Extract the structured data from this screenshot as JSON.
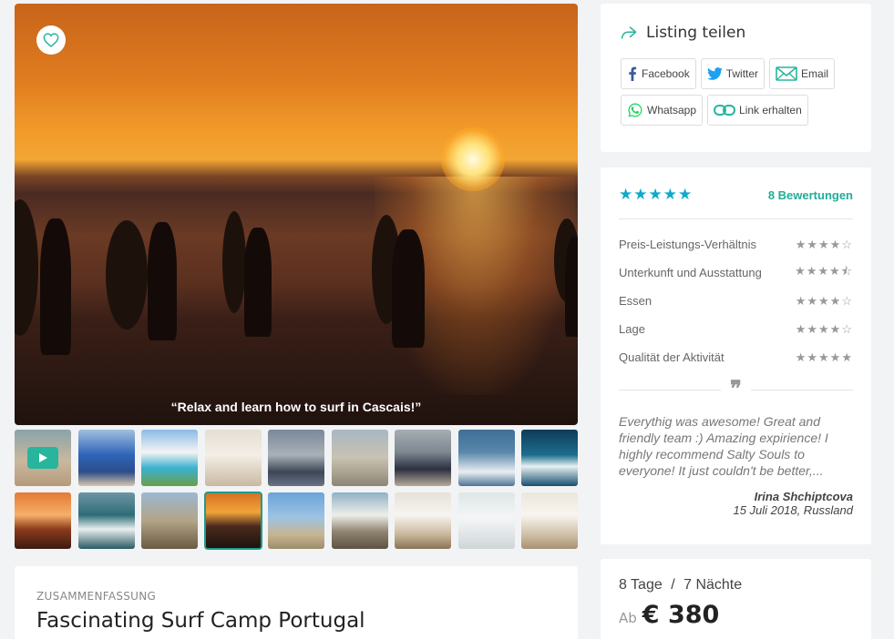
{
  "gallery": {
    "caption": "“Relax and learn how to surf in Cascais!”",
    "thumbnails": [
      {
        "bg": "linear-gradient(180deg,#8aa3a8 0%,#c9b8a0 55%,#b59a7a 100%)",
        "video": true
      },
      {
        "bg": "linear-gradient(180deg,#9fc0de 0%,#2f63b8 45%,#2d4d8a 75%,#d7c7ad 100%)"
      },
      {
        "bg": "linear-gradient(180deg,#8bbbe6 0%,#f4f4f4 40%,#3bb1d0 68%,#6a9f4a 100%)"
      },
      {
        "bg": "linear-gradient(180deg,#e5ded3 0%,#f3eee6 45%,#c9b9a0 100%)"
      },
      {
        "bg": "linear-gradient(180deg,#7a8899 0%,#a9b0b8 45%,#3d4656 75%,#6b7485 100%)"
      },
      {
        "bg": "linear-gradient(180deg,#a8b7c2 0%,#c9c2b2 50%,#8d8574 100%)"
      },
      {
        "bg": "linear-gradient(180deg,#a7aeb3 0%,#7e8790 40%,#2c3040 70%,#b7ab98 100%)"
      },
      {
        "bg": "linear-gradient(180deg,#3e6f96 0%,#5a87aa 40%,#e9eef2 75%,#4d7495 100%)"
      },
      {
        "bg": "linear-gradient(180deg,#0e3b58 0%,#1d6e8f 45%,#e8f0f2 65%,#154f6e 100%)"
      },
      {
        "bg": "linear-gradient(180deg,#e37a35 0%,#f5b06a 40%,#8c3b1c 65%,#3d1a10 100%)"
      },
      {
        "bg": "linear-gradient(180deg,#6e95a4 0%,#2e6c78 40%,#e9efef 65%,#2a5a63 100%)"
      },
      {
        "bg": "linear-gradient(180deg,#9cb9d3 0%,#b2a487 50%,#6a5a42 100%)"
      },
      {
        "bg": "linear-gradient(180deg,#d56f22 0%,#f1a43a 35%,#4a2a1d 60%,#1e120d 100%)",
        "active": true
      },
      {
        "bg": "linear-gradient(180deg,#6aa3d8 0%,#9ec3e3 45%,#c7b591 75%,#9d8c6b 100%)"
      },
      {
        "bg": "linear-gradient(180deg,#8fb1c6 0%,#efeee8 40%,#8e8270 70%,#5f5243 100%)"
      },
      {
        "bg": "linear-gradient(180deg,#e6e1d7 0%,#f7f5f0 40%,#c9b69a 75%,#8b7355 100%)"
      },
      {
        "bg": "linear-gradient(180deg,#dfe6e8 0%,#f4f6f6 45%,#cfd6d8 100%)"
      },
      {
        "bg": "linear-gradient(180deg,#ece6dc 0%,#f8f5ef 40%,#c8b79c 80%,#a89072 100%)"
      }
    ]
  },
  "summary": {
    "eyebrow": "ZUSAMMENFASSUNG",
    "title": "Fascinating Surf Camp Portugal"
  },
  "share": {
    "title": "Listing teilen",
    "buttons": [
      {
        "label": "Facebook",
        "icon": "facebook-icon"
      },
      {
        "label": "Twitter",
        "icon": "twitter-icon"
      },
      {
        "label": "Email",
        "icon": "email-icon"
      },
      {
        "label": "Whatsapp",
        "icon": "whatsapp-icon"
      },
      {
        "label": "Link erhalten",
        "icon": "link-icon"
      }
    ]
  },
  "ratings": {
    "overall_stars": "★★★★★",
    "count_label": "8 Bewertungen",
    "accent_color": "#10a9c9",
    "rows": [
      {
        "label": "Preis-Leistungs-Verhältnis",
        "stars": "★★★★☆"
      },
      {
        "label": "Unterkunft und Ausstattung",
        "stars": "★★★★⯪"
      },
      {
        "label": "Essen",
        "stars": "★★★★☆"
      },
      {
        "label": "Lage",
        "stars": "★★★★☆"
      },
      {
        "label": "Qualität der Aktivität",
        "stars": "★★★★★"
      }
    ],
    "quote_mark": "❞",
    "review_text": "Everythig was awesome! Great and friendly team :) Amazing expirience! I highly recommend Salty Souls to everyone! It just couldn't be better,...",
    "reviewer_name": "Irina Shchiptcova",
    "reviewer_meta": "15 Juli 2018, Russland"
  },
  "price": {
    "days": "8 Tage",
    "separator": "/",
    "nights": "7 Nächte",
    "from_label": "Ab",
    "amount": "€ 380"
  }
}
